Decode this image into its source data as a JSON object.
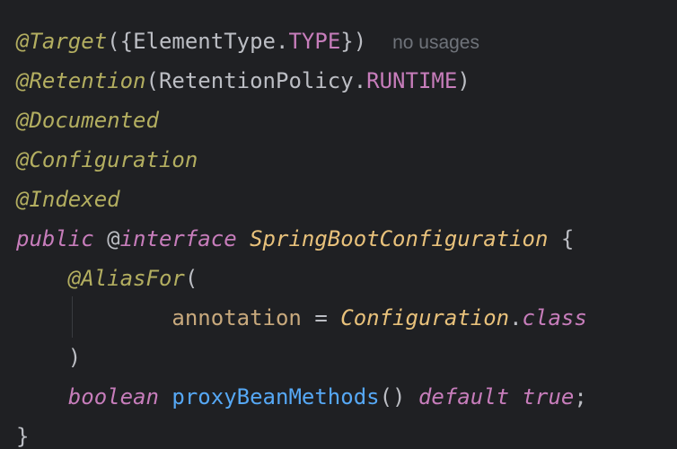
{
  "code": {
    "line1": {
      "annotation": "@Target",
      "open": "({",
      "type": "ElementType",
      "dot": ".",
      "constant": "TYPE",
      "close": "})",
      "hint": "no usages"
    },
    "line2": {
      "annotation": "@Retention",
      "open": "(",
      "type": "RetentionPolicy",
      "dot": ".",
      "constant": "RUNTIME",
      "close": ")"
    },
    "line3": {
      "annotation": "@Documented"
    },
    "line4": {
      "annotation": "@Configuration"
    },
    "line5": {
      "annotation": "@Indexed"
    },
    "line6": {
      "keyword_public": "public",
      "at": "@",
      "keyword_interface": "interface",
      "class_name": "SpringBootConfiguration",
      "brace": "{"
    },
    "line7": {
      "annotation": "@AliasFor",
      "open": "("
    },
    "line8": {
      "attribute": "annotation",
      "equals": "=",
      "class_ref": "Configuration",
      "dot": ".",
      "keyword_class": "class"
    },
    "line9": {
      "close": ")"
    },
    "line10": {
      "type": "boolean",
      "method": "proxyBeanMethods",
      "parens": "()",
      "keyword_default": "default",
      "value": "true",
      "semicolon": ";"
    },
    "line11": {
      "brace": "}"
    }
  },
  "colors": {
    "background": "#1f2023",
    "annotation": "#b3ae60",
    "keyword": "#cf8e6d",
    "constant": "#c77dbb",
    "method": "#56a8f5",
    "hint": "#6f737a",
    "text": "#bcbec4"
  }
}
